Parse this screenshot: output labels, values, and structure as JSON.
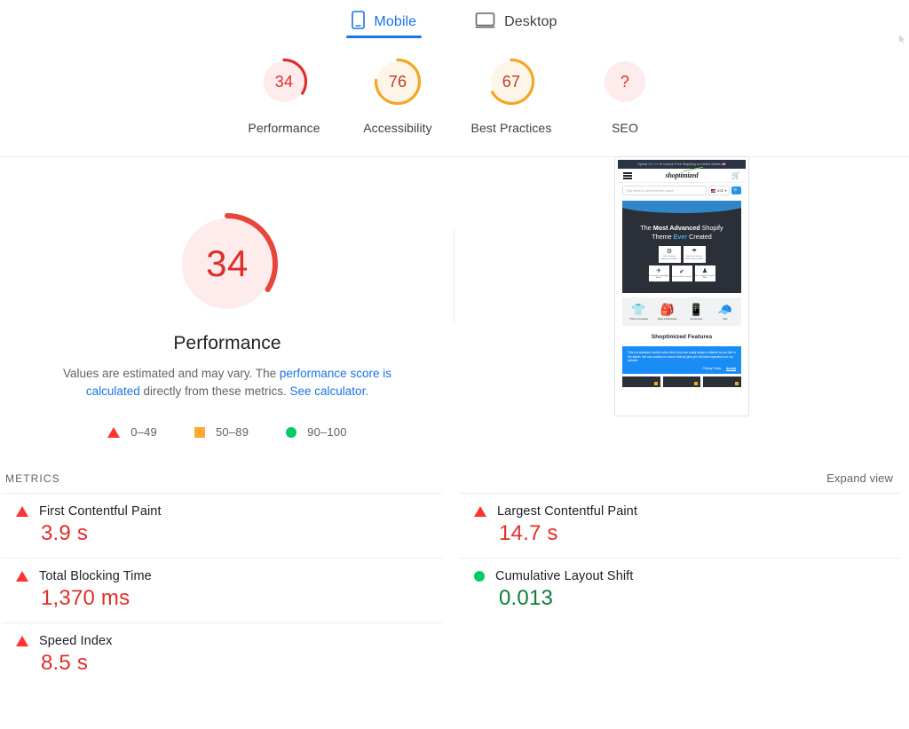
{
  "tabs": [
    {
      "label": "Mobile",
      "icon": "mobile-icon",
      "active": true
    },
    {
      "label": "Desktop",
      "icon": "desktop-icon",
      "active": false
    }
  ],
  "category_scores": [
    {
      "label": "Performance",
      "value": "34",
      "percent": 34,
      "color": "#e02e2a",
      "track": "#fdeceb"
    },
    {
      "label": "Accessibility",
      "value": "76",
      "percent": 76,
      "color": "#f5a623",
      "track": "#fef6e6"
    },
    {
      "label": "Best Practices",
      "value": "67",
      "percent": 67,
      "color": "#f5a623",
      "track": "#fef6e6"
    },
    {
      "label": "SEO",
      "value": "?",
      "percent": 0,
      "color": "#e02e2a",
      "track": "#fdeceb"
    }
  ],
  "performance": {
    "score": "34",
    "percent": 34,
    "title": "Performance",
    "description_prefix": "Values are estimated and may vary. The ",
    "description_link1": "performance score is calculated",
    "description_middle": " directly from these metrics. ",
    "description_link2": "See calculator.",
    "legend": [
      {
        "shape": "triangle",
        "label": "0–49",
        "color": "#ff3333"
      },
      {
        "shape": "square",
        "label": "50–89",
        "color": "#ffaa33"
      },
      {
        "shape": "circle",
        "label": "90–100",
        "color": "#00cc66"
      }
    ]
  },
  "screenshot": {
    "banner_prefix": "Spend ",
    "banner_amount": "$50.00",
    "banner_suffix": " to Unlock Free Shipping to United States ",
    "banner_flag": "🇺🇸",
    "logo": "shoptimized",
    "search_placeholder": "Type items/ to see predictive search",
    "currency": "USD",
    "hero_line1_a": "The ",
    "hero_line1_b": "Most Advanced",
    "hero_line1_c": " Shopify",
    "hero_line2_a": "Theme ",
    "hero_line2_b": "Ever",
    "hero_line2_c": " Created",
    "hero_cards": [
      {
        "glyph": "⚙",
        "label": "100+ Conversion\nImprovements Built In"
      },
      {
        "glyph": "☂",
        "label": "Buy Once & Get Free\nLifetime Theme Updates"
      },
      {
        "glyph": "✈",
        "label": "No Conversion\nKilling Apps Build In"
      },
      {
        "glyph": "✔",
        "label": "Loads In Under 1\nSecond"
      },
      {
        "glyph": "♟",
        "label": "Secure Support\n7 Days A Week"
      }
    ],
    "categories": [
      {
        "glyph": "👕",
        "label": "T-Shirts &\nHoodies"
      },
      {
        "glyph": "🎒",
        "label": "Bags &\nBackpacks"
      },
      {
        "glyph": "📱",
        "label": "Accessories"
      },
      {
        "glyph": "🧢",
        "label": "Hats"
      }
    ],
    "features_heading": "Shoptimized Features",
    "cookie_text": "This is a standard cookie notice which you can easily adapt or disable as you like in the admin. We use cookies to ensure that we give you the best experience on our website.",
    "cookie_privacy": "Privacy Policy",
    "cookie_accept": "Accept"
  },
  "metrics_section": {
    "title": "METRICS",
    "expand_view": "Expand view",
    "left_column": [
      {
        "icon": "triangle",
        "name": "First Contentful Paint",
        "value": "3.9 s",
        "value_color": "red"
      },
      {
        "icon": "triangle",
        "name": "Total Blocking Time",
        "value": "1,370 ms",
        "value_color": "red"
      },
      {
        "icon": "triangle",
        "name": "Speed Index",
        "value": "8.5 s",
        "value_color": "red"
      }
    ],
    "right_column": [
      {
        "icon": "triangle",
        "name": "Largest Contentful Paint",
        "value": "14.7 s",
        "value_color": "red"
      },
      {
        "icon": "circle",
        "name": "Cumulative Layout Shift",
        "value": "0.013",
        "value_color": "green"
      }
    ]
  },
  "colors": {
    "accent_blue": "#1a73e8",
    "error_red": "#e02e2a",
    "warn_orange": "#f5a623",
    "pass_green": "#0a8039"
  }
}
